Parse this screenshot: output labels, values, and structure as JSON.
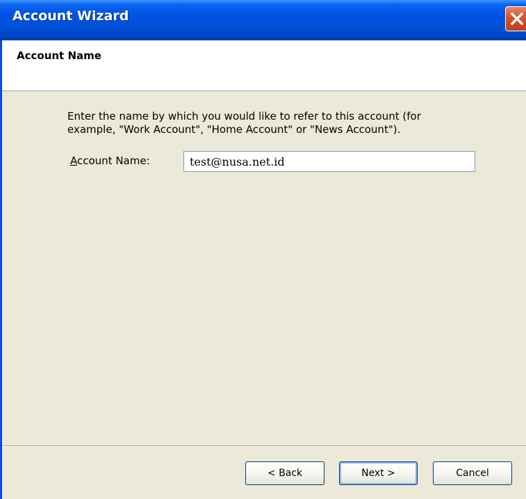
{
  "window": {
    "title": "Account Wizard",
    "close_icon": "close-icon"
  },
  "header": {
    "title": "Account Name"
  },
  "content": {
    "description_line1": "Enter the name by which you would like to refer to this account (for",
    "description_line2": "example, \"Work Account\", \"Home Account\" or \"News Account\").",
    "field": {
      "label_accesskey": "A",
      "label_rest": "ccount Name:",
      "value": "test@nusa.net.id"
    }
  },
  "buttons": {
    "back": "< Back",
    "next": "Next >",
    "cancel": "Cancel"
  },
  "colors": {
    "titlebar": "#0054e3",
    "dialog_background": "#ece9d8",
    "close_button": "#d9542f"
  }
}
